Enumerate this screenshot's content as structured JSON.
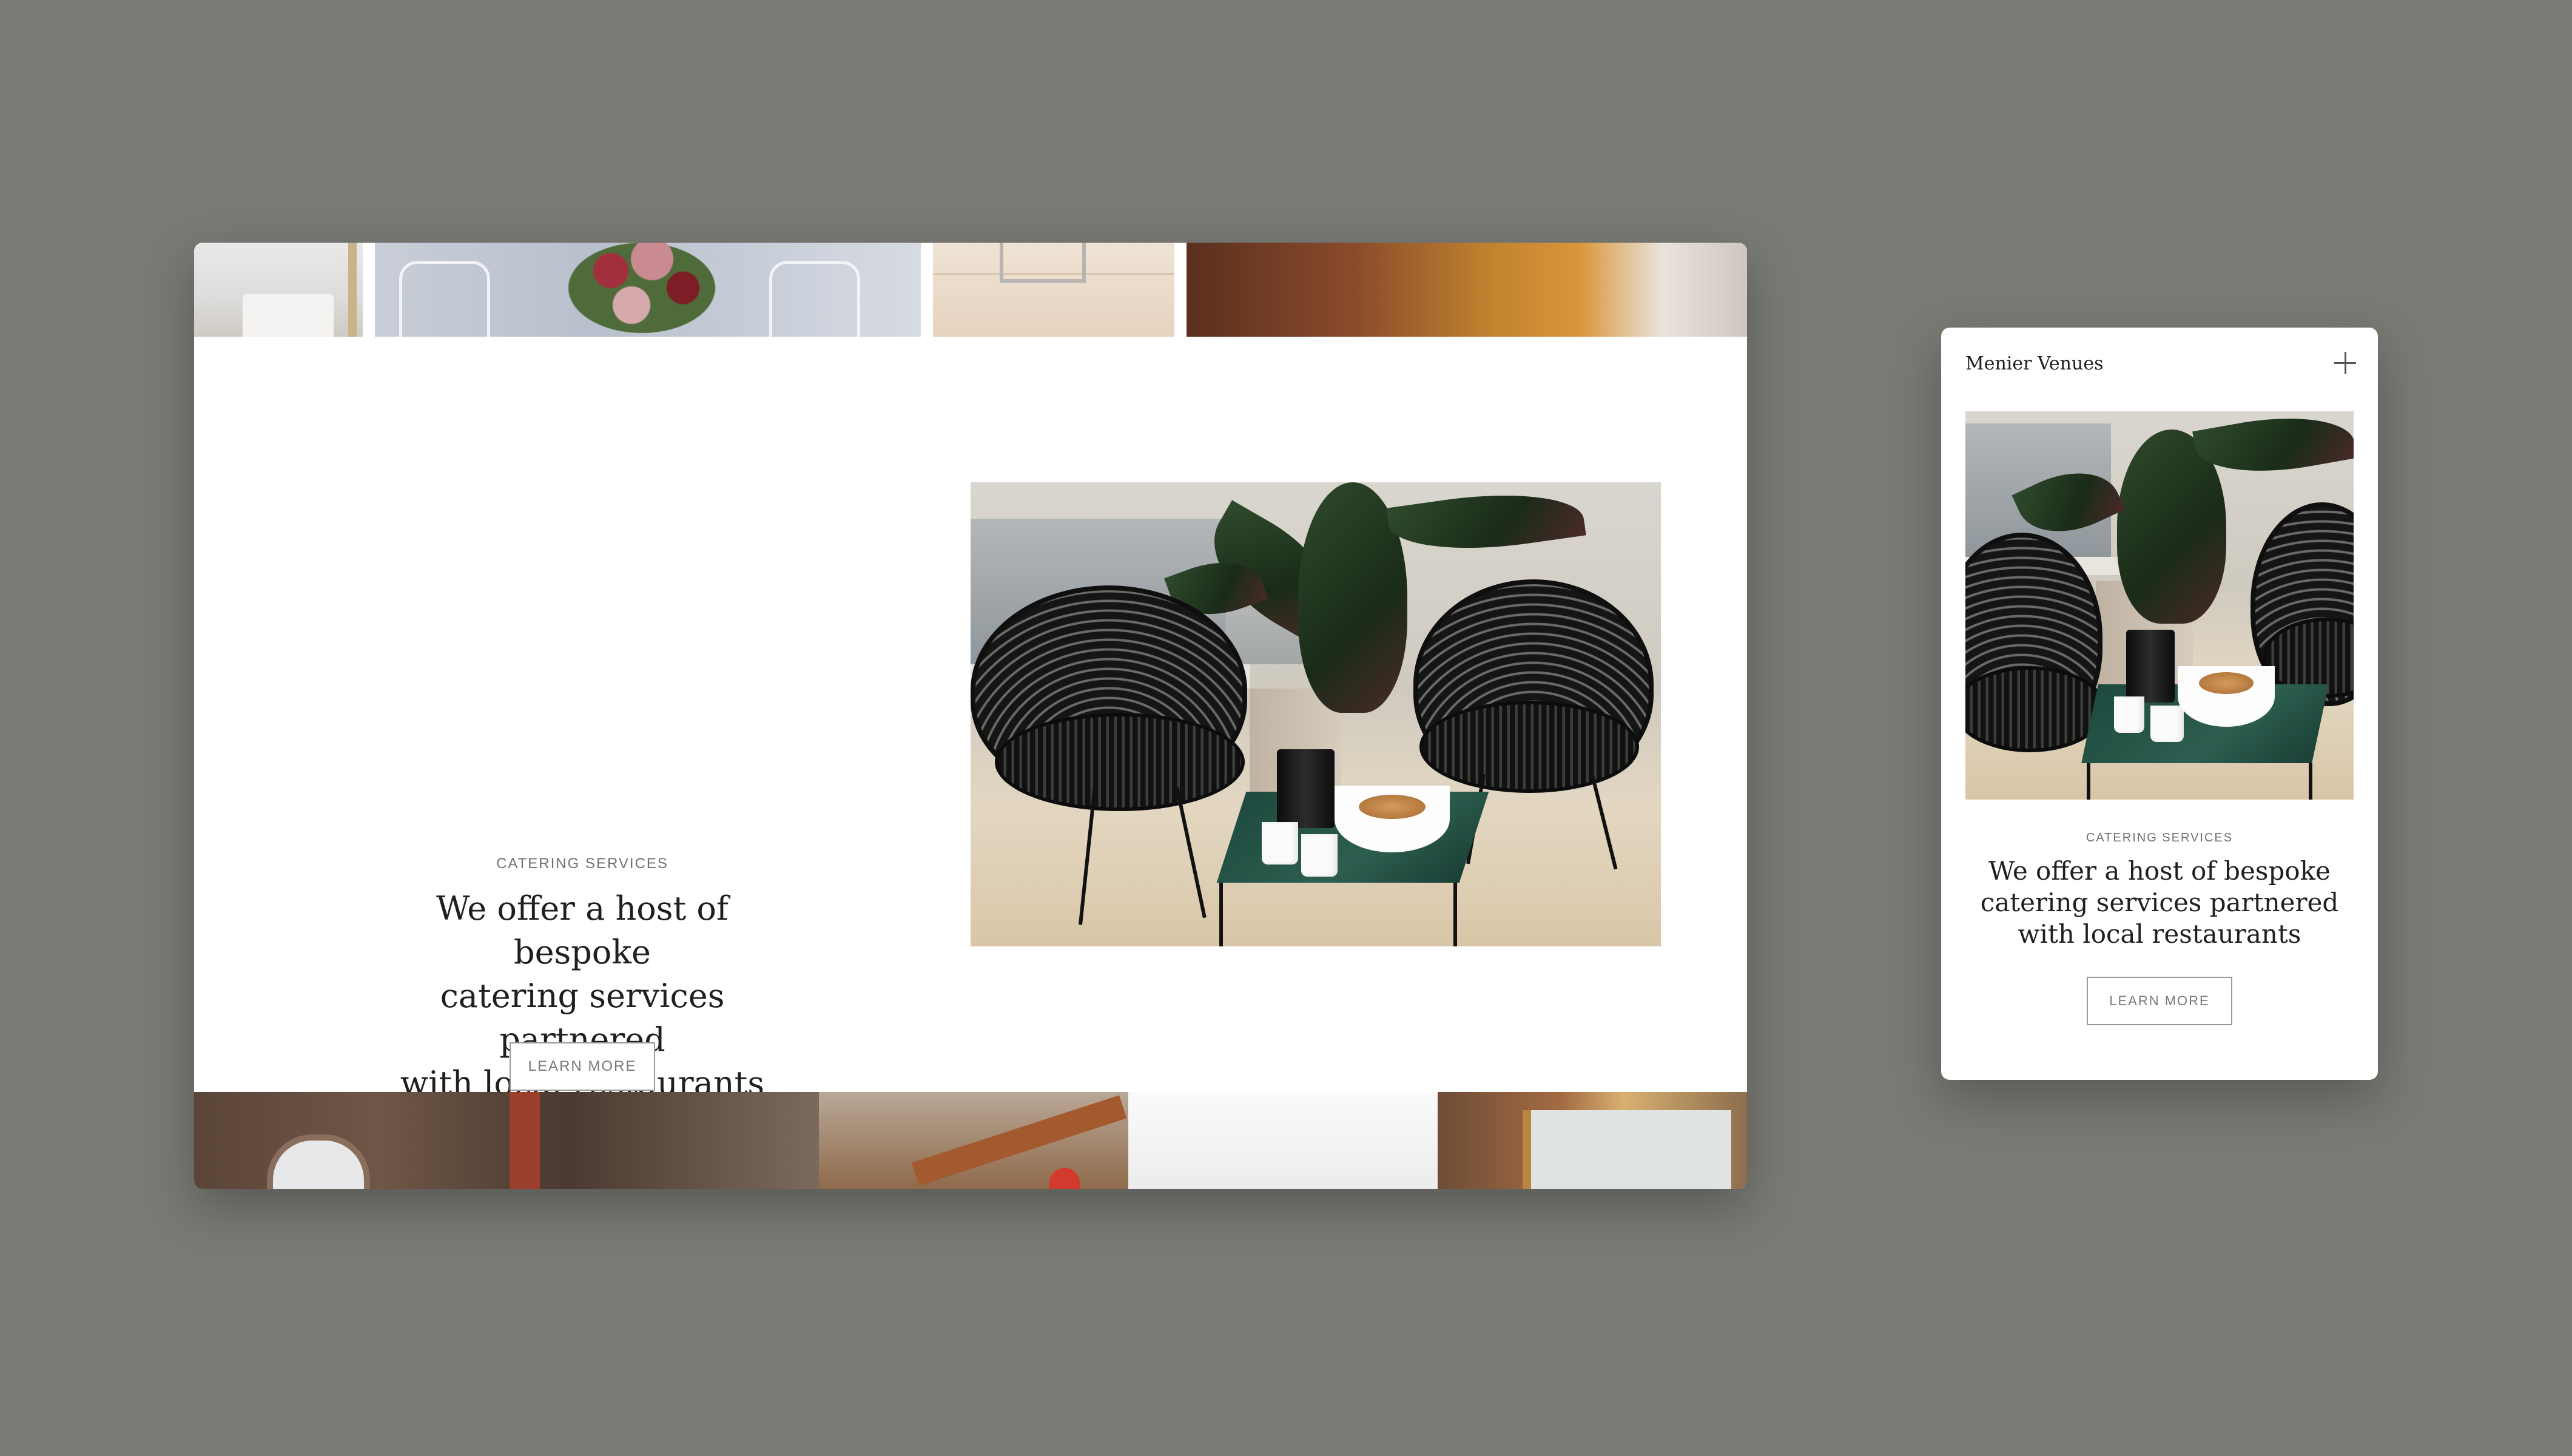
{
  "desktop": {
    "section": {
      "eyebrow": "CATERING SERVICES",
      "heading_lines": [
        "We offer a host of bespoke",
        "catering services partnered",
        "with local restaurants"
      ],
      "button_label": "LEARN MORE"
    },
    "gallery_top_count": 4,
    "gallery_bottom_count": 4
  },
  "mobile": {
    "brand": "Menier Venues",
    "menu_icon": "plus-icon",
    "section": {
      "eyebrow": "CATERING SERVICES",
      "heading_lines": [
        "We offer a host of bespoke",
        "catering services partnered",
        "with local restaurants"
      ],
      "button_label": "LEARN MORE"
    }
  },
  "colors": {
    "background": "#7a7a75",
    "card": "#ffffff",
    "heading": "#1f1f1f",
    "muted": "#707070"
  }
}
